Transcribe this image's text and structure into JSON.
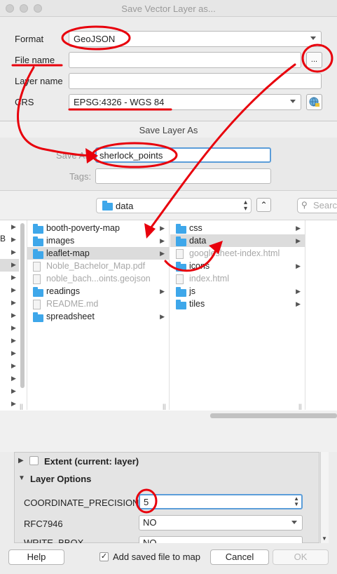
{
  "window": {
    "title": "Save Vector Layer as..."
  },
  "form": {
    "format_label": "Format",
    "format_value": "GeoJSON",
    "filename_label": "File name",
    "browse_label": "...",
    "layername_label": "Layer name",
    "crs_label": "CRS",
    "crs_value": "EPSG:4326 - WGS 84"
  },
  "save_sheet": {
    "title": "Save Layer As",
    "save_as_label": "Save As:",
    "save_as_value": "sherlock_points",
    "tags_label": "Tags:",
    "location": "data",
    "search_placeholder": "Search",
    "left_col_fragment": "B"
  },
  "columns": {
    "col1": [
      {
        "name": "booth-poverty-map",
        "type": "folder",
        "dim": false,
        "arrow": true
      },
      {
        "name": "images",
        "type": "folder",
        "dim": false,
        "arrow": true
      },
      {
        "name": "leaflet-map",
        "type": "folder",
        "dim": false,
        "arrow": true,
        "selected": true
      },
      {
        "name": "Noble_Bachelor_Map.pdf",
        "type": "file",
        "dim": true,
        "arrow": false
      },
      {
        "name": "noble_bach...oints.geojson",
        "type": "file",
        "dim": true,
        "arrow": false
      },
      {
        "name": "readings",
        "type": "folder",
        "dim": false,
        "arrow": true
      },
      {
        "name": "README.md",
        "type": "file",
        "dim": true,
        "arrow": false
      },
      {
        "name": "spreadsheet",
        "type": "folder",
        "dim": false,
        "arrow": true
      }
    ],
    "col2": [
      {
        "name": "css",
        "type": "folder",
        "dim": false,
        "arrow": true
      },
      {
        "name": "data",
        "type": "folder",
        "dim": false,
        "arrow": true,
        "selected": true
      },
      {
        "name": "googlesheet-index.html",
        "type": "file",
        "dim": true,
        "arrow": false
      },
      {
        "name": "icons",
        "type": "folder",
        "dim": false,
        "arrow": true
      },
      {
        "name": "index.html",
        "type": "file",
        "dim": true,
        "arrow": false
      },
      {
        "name": "js",
        "type": "folder",
        "dim": false,
        "arrow": true
      },
      {
        "name": "tiles",
        "type": "folder",
        "dim": false,
        "arrow": true
      }
    ]
  },
  "options": {
    "extent_label": "Extent (current: layer)",
    "layer_options_label": "Layer Options",
    "coord_precision_label": "COORDINATE_PRECISION",
    "coord_precision_value": "5",
    "rfc_label": "RFC7946",
    "rfc_value": "NO",
    "write_bbox_label": "WRITE_BBOX",
    "write_bbox_value": "NO"
  },
  "buttons": {
    "help": "Help",
    "add_to_map": "Add saved file to map",
    "cancel": "Cancel",
    "ok": "OK"
  },
  "colors": {
    "annotation_red": "#e8000c",
    "folder_blue": "#3ea7ea",
    "focus_blue": "#5b9dd9"
  }
}
